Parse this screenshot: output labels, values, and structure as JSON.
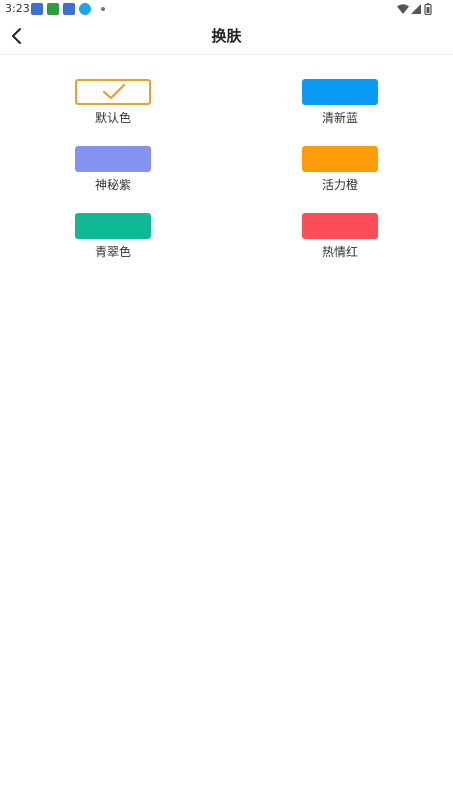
{
  "status_bar": {
    "time": "3:23"
  },
  "header": {
    "title": "换肤",
    "back_icon": "chevron-left-icon"
  },
  "themes": [
    {
      "label": "默认色",
      "color": "#ffffff",
      "border": "#e8a030",
      "selected": true
    },
    {
      "label": "清新蓝",
      "color": "#0a9cf5",
      "selected": false
    },
    {
      "label": "神秘紫",
      "color": "#8592ef",
      "selected": false
    },
    {
      "label": "活力橙",
      "color": "#ff9c0a",
      "selected": false
    },
    {
      "label": "青翠色",
      "color": "#10b894",
      "selected": false
    },
    {
      "label": "热情红",
      "color": "#fc4d58",
      "selected": false
    }
  ]
}
